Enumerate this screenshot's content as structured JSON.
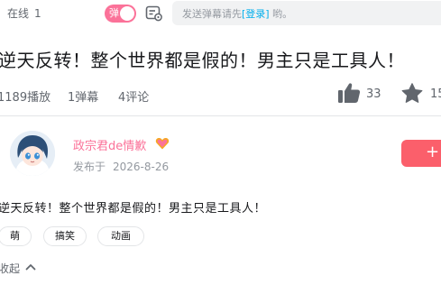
{
  "topbar": {
    "online_label": "在线",
    "online_count": "1",
    "danmaku_toggle_label": "弹",
    "input_placeholder_prefix": "发送弹幕请先",
    "input_login_link": "[登录]",
    "input_placeholder_suffix": "哟。"
  },
  "video": {
    "title": "逆天反转！整个世界都是假的！男主只是工具人！",
    "plays": "1189播放",
    "danmaku": "1弹幕",
    "comments": "4评论",
    "likes": "33",
    "coins": "15"
  },
  "uploader": {
    "name": "政宗君de情歉",
    "published_label": "发布于",
    "published_date": "2026-8-26",
    "follow_label": "+"
  },
  "description": "逆天反转！整个世界都是假的！男主只是工具人！",
  "tags": [
    "萌",
    "搞笑",
    "动画"
  ],
  "collapse_label": "收起",
  "colors": {
    "accent_pink": "#fb7299",
    "follow_red": "#fb5f6b",
    "link_blue": "#00aeec"
  }
}
